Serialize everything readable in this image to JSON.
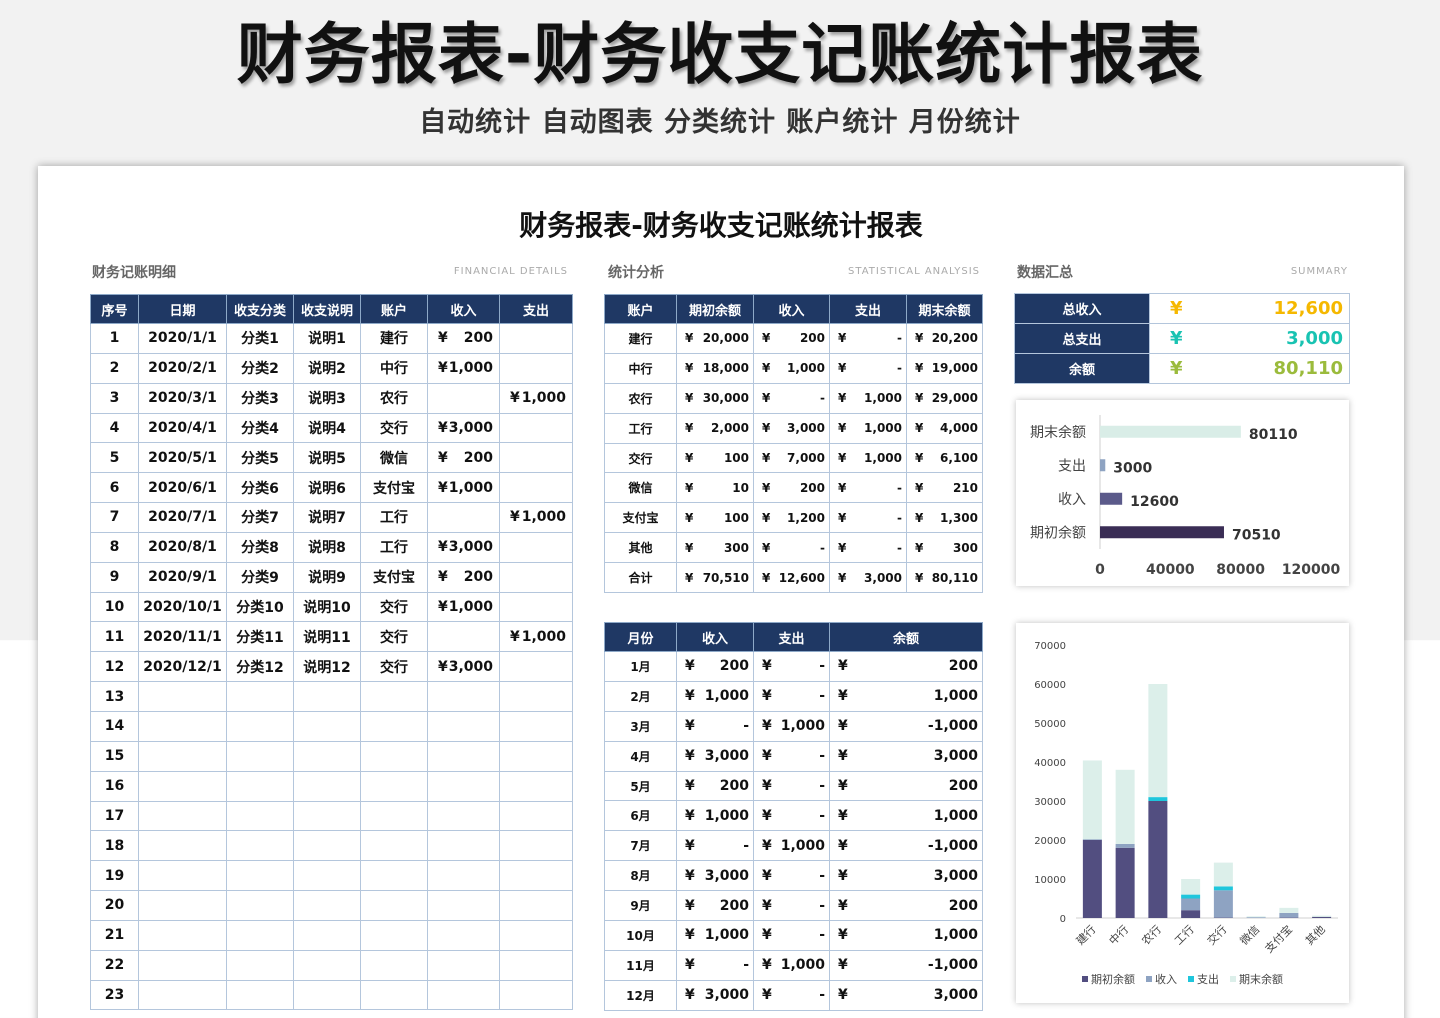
{
  "hero": {
    "title": "财务报表-财务收支记账统计报表",
    "subtitle": "自动统计 自动图表 分类统计 账户统计 月份统计"
  },
  "sheet": {
    "title": "财务报表-财务收支记账统计报表"
  },
  "sections": {
    "detail": {
      "label": "财务记账明细",
      "en": "FINANCIAL  DETAILS"
    },
    "stat": {
      "label": "统计分析",
      "en": "STATISTICAL ANALYSIS"
    },
    "summary": {
      "label": "数据汇总",
      "en": "SUMMARY"
    }
  },
  "currency": "¥",
  "detail_table": {
    "headers": [
      "序号",
      "日期",
      "收支分类",
      "收支说明",
      "账户",
      "收入",
      "支出"
    ],
    "rows": [
      [
        "1",
        "2020/1/1",
        "分类1",
        "说明1",
        "建行",
        "200",
        ""
      ],
      [
        "2",
        "2020/2/1",
        "分类2",
        "说明2",
        "中行",
        "1,000",
        ""
      ],
      [
        "3",
        "2020/3/1",
        "分类3",
        "说明3",
        "农行",
        "",
        "1,000"
      ],
      [
        "4",
        "2020/4/1",
        "分类4",
        "说明4",
        "交行",
        "3,000",
        ""
      ],
      [
        "5",
        "2020/5/1",
        "分类5",
        "说明5",
        "微信",
        "200",
        ""
      ],
      [
        "6",
        "2020/6/1",
        "分类6",
        "说明6",
        "支付宝",
        "1,000",
        ""
      ],
      [
        "7",
        "2020/7/1",
        "分类7",
        "说明7",
        "工行",
        "",
        "1,000"
      ],
      [
        "8",
        "2020/8/1",
        "分类8",
        "说明8",
        "工行",
        "3,000",
        ""
      ],
      [
        "9",
        "2020/9/1",
        "分类9",
        "说明9",
        "支付宝",
        "200",
        ""
      ],
      [
        "10",
        "2020/10/1",
        "分类10",
        "说明10",
        "交行",
        "1,000",
        ""
      ],
      [
        "11",
        "2020/11/1",
        "分类11",
        "说明11",
        "交行",
        "",
        "1,000"
      ],
      [
        "12",
        "2020/12/1",
        "分类12",
        "说明12",
        "交行",
        "3,000",
        ""
      ],
      [
        "13",
        "",
        "",
        "",
        "",
        "",
        ""
      ],
      [
        "14",
        "",
        "",
        "",
        "",
        "",
        ""
      ],
      [
        "15",
        "",
        "",
        "",
        "",
        "",
        ""
      ],
      [
        "16",
        "",
        "",
        "",
        "",
        "",
        ""
      ],
      [
        "17",
        "",
        "",
        "",
        "",
        "",
        ""
      ],
      [
        "18",
        "",
        "",
        "",
        "",
        "",
        ""
      ],
      [
        "19",
        "",
        "",
        "",
        "",
        "",
        ""
      ],
      [
        "20",
        "",
        "",
        "",
        "",
        "",
        ""
      ],
      [
        "21",
        "",
        "",
        "",
        "",
        "",
        ""
      ],
      [
        "22",
        "",
        "",
        "",
        "",
        "",
        ""
      ],
      [
        "23",
        "",
        "",
        "",
        "",
        "",
        ""
      ]
    ]
  },
  "account_table": {
    "headers": [
      "账户",
      "期初余额",
      "收入",
      "支出",
      "期末余额"
    ],
    "rows": [
      [
        "建行",
        "20,000",
        "200",
        "-",
        "20,200"
      ],
      [
        "中行",
        "18,000",
        "1,000",
        "-",
        "19,000"
      ],
      [
        "农行",
        "30,000",
        "-",
        "1,000",
        "29,000"
      ],
      [
        "工行",
        "2,000",
        "3,000",
        "1,000",
        "4,000"
      ],
      [
        "交行",
        "100",
        "7,000",
        "1,000",
        "6,100"
      ],
      [
        "微信",
        "10",
        "200",
        "-",
        "210"
      ],
      [
        "支付宝",
        "100",
        "1,200",
        "-",
        "1,300"
      ],
      [
        "其他",
        "300",
        "-",
        "-",
        "300"
      ],
      [
        "合计",
        "70,510",
        "12,600",
        "3,000",
        "80,110"
      ]
    ]
  },
  "month_table": {
    "headers": [
      "月份",
      "收入",
      "支出",
      "余额"
    ],
    "rows": [
      [
        "1月",
        "200",
        "-",
        "200"
      ],
      [
        "2月",
        "1,000",
        "-",
        "1,000"
      ],
      [
        "3月",
        "-",
        "1,000",
        "-1,000"
      ],
      [
        "4月",
        "3,000",
        "-",
        "3,000"
      ],
      [
        "5月",
        "200",
        "-",
        "200"
      ],
      [
        "6月",
        "1,000",
        "-",
        "1,000"
      ],
      [
        "7月",
        "-",
        "1,000",
        "-1,000"
      ],
      [
        "8月",
        "3,000",
        "-",
        "3,000"
      ],
      [
        "9月",
        "200",
        "-",
        "200"
      ],
      [
        "10月",
        "1,000",
        "-",
        "1,000"
      ],
      [
        "11月",
        "-",
        "1,000",
        "-1,000"
      ],
      [
        "12月",
        "3,000",
        "-",
        "3,000"
      ]
    ]
  },
  "summary": {
    "rows": [
      {
        "label": "总收入",
        "value": "12,600",
        "color": "#f5b800"
      },
      {
        "label": "总支出",
        "value": "3,000",
        "color": "#19c3b2"
      },
      {
        "label": "余额",
        "value": "80,110",
        "color": "#9bbb3c"
      }
    ]
  },
  "chart_data": [
    {
      "type": "bar",
      "orientation": "horizontal",
      "categories": [
        "期末余额",
        "支出",
        "收入",
        "期初余额"
      ],
      "values": [
        80110,
        3000,
        12600,
        70510
      ],
      "colors": [
        "#d9ede7",
        "#8ea3c2",
        "#5b5a8a",
        "#3a2d55"
      ],
      "xlim": [
        0,
        120000
      ],
      "xticks": [
        "0",
        "40000",
        "80000",
        "120000"
      ],
      "data_labels": [
        "80110",
        "3000",
        "12600",
        "70510"
      ]
    },
    {
      "type": "bar",
      "stacked": true,
      "categories": [
        "建行",
        "中行",
        "农行",
        "工行",
        "交行",
        "微信",
        "支付宝",
        "其他"
      ],
      "series": [
        {
          "name": "期初余额",
          "values": [
            20000,
            18000,
            30000,
            2000,
            100,
            10,
            100,
            300
          ],
          "color": "#524e80"
        },
        {
          "name": "收入",
          "values": [
            200,
            1000,
            0,
            3000,
            7000,
            200,
            1200,
            0
          ],
          "color": "#8ea3c2"
        },
        {
          "name": "支出",
          "values": [
            0,
            0,
            1000,
            1000,
            1000,
            0,
            0,
            0
          ],
          "color": "#1fc6dc"
        },
        {
          "name": "期末余额",
          "values": [
            20200,
            19000,
            29000,
            4000,
            6100,
            210,
            1300,
            300
          ],
          "color": "#dcefea"
        }
      ],
      "ylim": [
        0,
        70000
      ],
      "yticks": [
        "0",
        "10000",
        "20000",
        "30000",
        "40000",
        "50000",
        "60000",
        "70000"
      ],
      "legend": "bottom"
    }
  ]
}
